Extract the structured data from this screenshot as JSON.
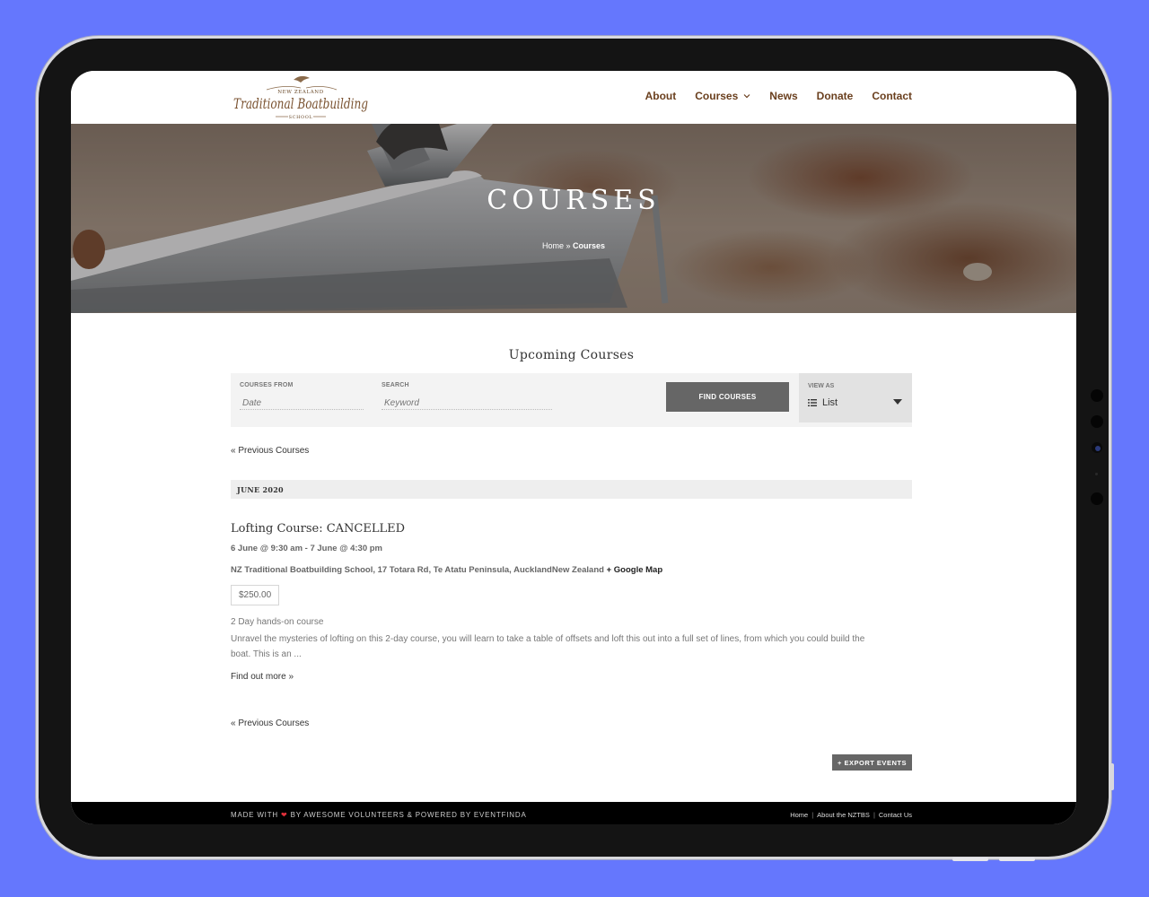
{
  "site": {
    "logo_top": "NEW ZEALAND",
    "logo_main": "Traditional Boatbuilding",
    "logo_bottom": "SCHOOL"
  },
  "nav": {
    "items": [
      {
        "label": "About"
      },
      {
        "label": "Courses"
      },
      {
        "label": "News"
      },
      {
        "label": "Donate"
      },
      {
        "label": "Contact"
      }
    ]
  },
  "hero": {
    "title": "COURSES",
    "breadcrumb_home": "Home",
    "breadcrumb_sep": " » ",
    "breadcrumb_current": "Courses"
  },
  "main": {
    "section_title": "Upcoming Courses",
    "filter": {
      "from_label": "COURSES FROM",
      "from_placeholder": "Date",
      "search_label": "SEARCH",
      "search_placeholder": "Keyword",
      "find_button": "FIND COURSES",
      "view_label": "VIEW AS",
      "view_value": "List"
    },
    "prev_link": "« Previous Courses",
    "month": "JUNE 2020",
    "event": {
      "title": "Lofting Course: CANCELLED",
      "date": "6 June @ 9:30 am - 7 June @ 4:30 pm",
      "venue": "NZ Traditional Boatbuilding School, 17 Totara Rd, Te Atatu Peninsula, AucklandNew Zealand",
      "map_link": "+ Google Map",
      "price": "$250.00",
      "desc_head": "2 Day hands-on course",
      "desc_body": "Unravel the mysteries of lofting on this 2-day course, you will learn to take a table of offsets and loft this out into a full set of lines, from which you could build the boat. This is an ...",
      "find_more": "Find out more »"
    },
    "prev_link_bottom": "« Previous Courses",
    "export_button": "+ EXPORT EVENTS"
  },
  "footer": {
    "made_with": "MADE WITH",
    "heart": "❤",
    "by": "BY AWESOME VOLUNTEERS & POWERED BY EVENTFINDA",
    "links": [
      "Home",
      "About the NZTBS",
      "Contact Us"
    ]
  },
  "colors": {
    "page_bg": "#6577fd",
    "nav_text": "#6a3f1e",
    "button_bg": "#666666",
    "footer_bg": "#000000",
    "heart": "#e0303b"
  }
}
